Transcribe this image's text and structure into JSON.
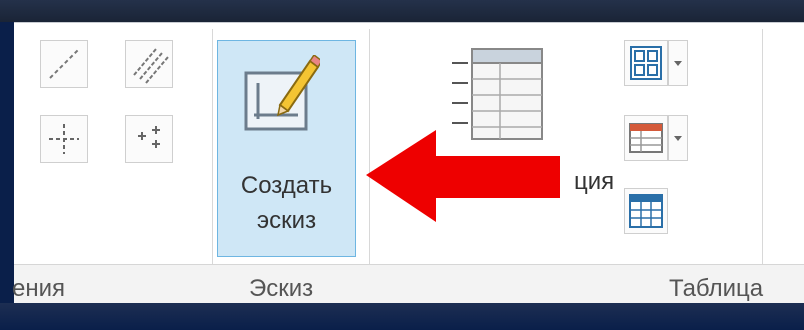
{
  "groups": {
    "left_partial_label": "ения",
    "sketch_label": "Эскиз",
    "table_label": "Таблица"
  },
  "sketch_button": {
    "label_line1": "Создать",
    "label_line2": "эскиз"
  },
  "table_tool": {
    "partial_label": "ция"
  },
  "icons": [
    "line-dash-icon",
    "parallel-lines-icon",
    "crosshair-icon",
    "point-pattern-icon",
    "sketch-pencil-icon",
    "table-list-icon",
    "grid-icon",
    "table-icon",
    "table-small-icon",
    "dropdown-icon"
  ],
  "colors": {
    "highlight_bg": "#cfe7f6",
    "highlight_border": "#6eb6e2",
    "arrow": "#ee0000",
    "background": "#0a1f4a"
  }
}
